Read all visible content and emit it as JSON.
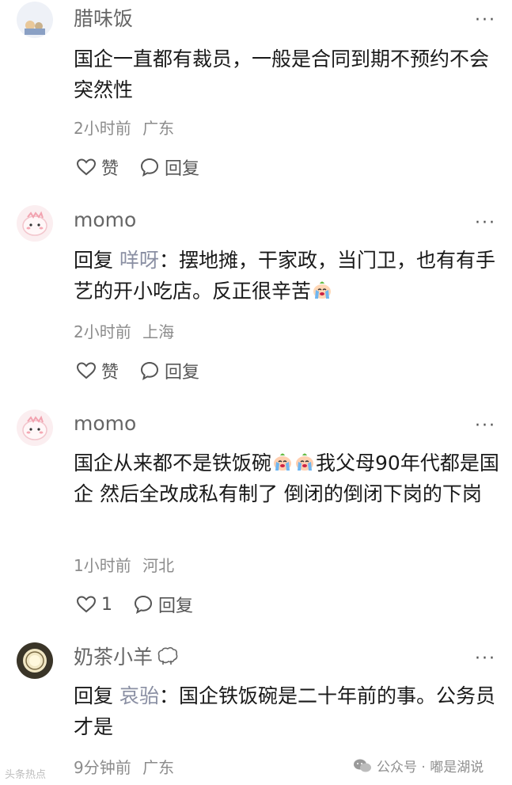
{
  "comments": [
    {
      "username": "腊味饭",
      "text": "国企一直都有裁员，一般是合同到期不预约不会突然性",
      "time": "2小时前",
      "location": "广东",
      "like_label": "赞",
      "reply_label": "回复"
    },
    {
      "username": "momo",
      "reply_prefix": "回复",
      "reply_target": "咩呀",
      "text": "：摆地摊，干家政，当门卫，也有有手艺的开小吃店。反正很辛苦",
      "time": "2小时前",
      "location": "上海",
      "like_label": "赞",
      "reply_label": "回复"
    },
    {
      "username": "momo",
      "text_a": "国企从来都不是铁饭碗",
      "text_b": "我父母90年代都是国企 然后全改成私有制了 倒闭的倒闭下岗的下岗",
      "time": "1小时前",
      "location": "河北",
      "like_count": "1",
      "reply_label": "回复"
    },
    {
      "username": "奶茶小羊",
      "reply_prefix": "回复",
      "reply_target": "哀骀",
      "text": "：国企铁饭碗是二十年前的事。公务员才是",
      "time": "9分钟前",
      "location": "广东"
    }
  ],
  "more_label": "···",
  "watermark_left": "头条热点",
  "watermark_right": "公众号 · 嘟是湖说"
}
